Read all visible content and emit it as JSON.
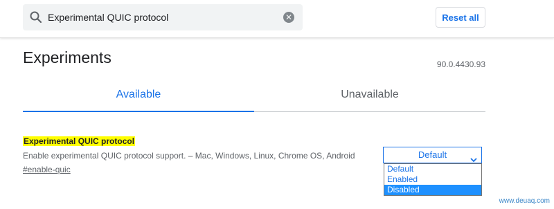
{
  "search": {
    "value": "Experimental QUIC protocol",
    "icon": "search-icon",
    "clear_icon": "clear-icon"
  },
  "header": {
    "reset_label": "Reset all"
  },
  "page": {
    "title": "Experiments",
    "version": "90.0.4430.93"
  },
  "tabs": [
    {
      "label": "Available",
      "active": true
    },
    {
      "label": "Unavailable",
      "active": false
    }
  ],
  "experiment": {
    "title": "Experimental QUIC protocol",
    "description": "Enable experimental QUIC protocol support. – Mac, Windows, Linux, Chrome OS, Android",
    "link": "#enable-quic",
    "selected_value": "Default",
    "options": [
      {
        "label": "Default",
        "highlighted": false
      },
      {
        "label": "Enabled",
        "highlighted": false
      },
      {
        "label": "Disabled",
        "highlighted": true
      }
    ]
  },
  "watermark": "www.deuaq.com",
  "colors": {
    "accent": "#1a73e8",
    "highlight": "#ffff00",
    "option_selected": "#1e90ff"
  }
}
